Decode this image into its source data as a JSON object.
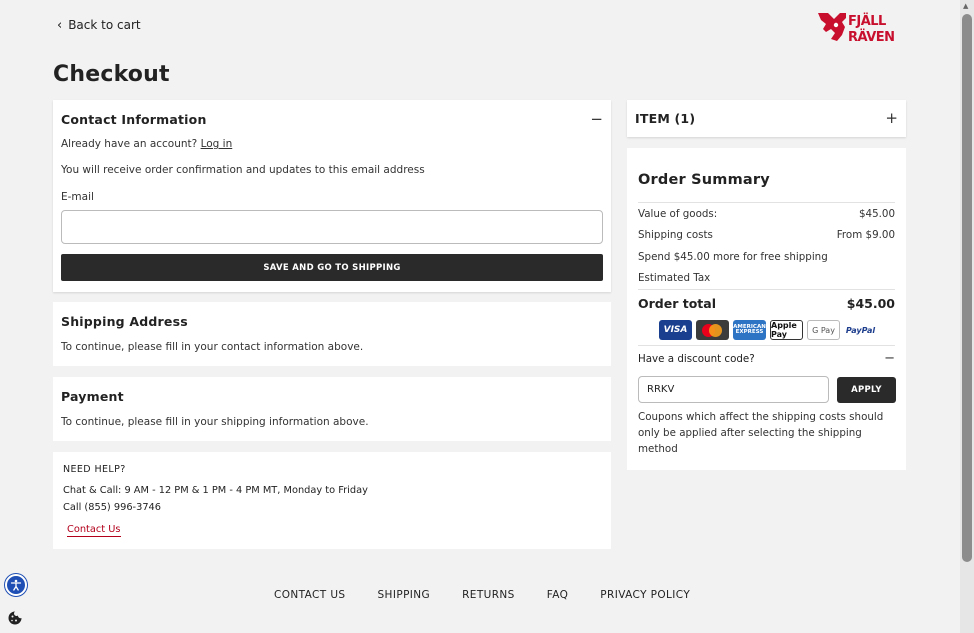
{
  "header": {
    "back_label": "Back to cart",
    "logo_text_line1": "FJÄLL",
    "logo_text_line2": "RÄVEN",
    "logo_color": "#c8102e",
    "page_title": "Checkout"
  },
  "contact": {
    "title": "Contact Information",
    "collapse_symbol": "−",
    "account_prefix": "Already have an account?",
    "login_label": "Log in",
    "notice": "You will receive order confirmation and updates to this email address",
    "email_label": "E-mail",
    "email_value": "",
    "save_button": "SAVE AND GO TO SHIPPING"
  },
  "shipping": {
    "title": "Shipping Address",
    "text": "To continue, please fill in your contact information above."
  },
  "payment": {
    "title": "Payment",
    "text": "To continue, please fill in your shipping information above."
  },
  "help": {
    "title": "NEED HELP?",
    "hours": "Chat & Call: 9 AM - 12 PM & 1 PM - 4 PM MT, Monday to Friday",
    "phone": "Call (855) 996-3746",
    "contact_link": "Contact Us"
  },
  "items": {
    "label": "ITEM (1)",
    "expand_symbol": "+"
  },
  "summary": {
    "title": "Order Summary",
    "rows": [
      {
        "label": "Value of goods:",
        "value": "$45.00"
      },
      {
        "label": "Shipping costs",
        "value": "From $9.00"
      },
      {
        "label": "Spend $45.00 more for free shipping",
        "value": ""
      },
      {
        "label": "Estimated Tax",
        "value": ""
      }
    ],
    "total_label": "Order total",
    "total_value": "$45.00",
    "payment_methods": [
      "VISA",
      "Mastercard",
      "AMERICAN EXPRESS",
      "Apple Pay",
      "G Pay",
      "PayPal"
    ],
    "discount_label": "Have a discount code?",
    "discount_toggle": "−",
    "discount_value": "RRKV",
    "apply_button": "APPLY",
    "coupon_note": "Coupons which affect the shipping costs should only be applied after selecting the shipping method"
  },
  "footer": {
    "links": [
      "CONTACT US",
      "SHIPPING",
      "RETURNS",
      "FAQ",
      "PRIVACY POLICY"
    ]
  },
  "colors": {
    "brand_red": "#c8102e",
    "button_dark": "#2a2a2a",
    "link_red": "#b3001b",
    "accessibility_blue": "#1f4fb4"
  }
}
